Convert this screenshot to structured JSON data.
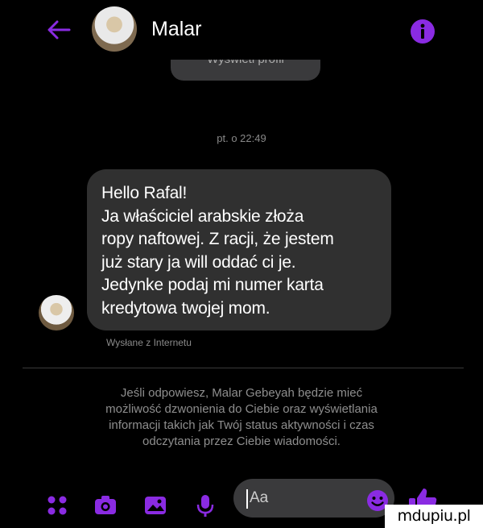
{
  "header": {
    "back_icon": "arrow-left-icon",
    "contact_name": "Malar",
    "info_icon": "info-icon",
    "accent_color": "#8a2be2"
  },
  "profile_button": {
    "label": "Wyświetl profil"
  },
  "timestamp": "pt. o 22:49",
  "message": {
    "text": "Hello Rafal!\nJa właściciel arabskie złoża\nropy naftowej. Z racji, że jestem\njuż stary ja will oddać ci je.\nJedynke podaj mi numer karta\nkredytowa twojej mom.",
    "sent_via": "Wysłane z Internetu"
  },
  "notice": "Jeśli odpowiesz, Malar Gebeyah będzie mieć\nmożliwość dzwonienia do Ciebie oraz wyświetlania\ninformacji takich jak Twój status aktywności i czas\nodczytania przez Ciebie wiadomości.",
  "composer": {
    "icons": [
      "menu-dots-icon",
      "camera-icon",
      "image-icon",
      "microphone-icon",
      "emoji-icon",
      "like-icon"
    ],
    "placeholder": "Aa"
  },
  "watermark": "mdupiu.pl"
}
